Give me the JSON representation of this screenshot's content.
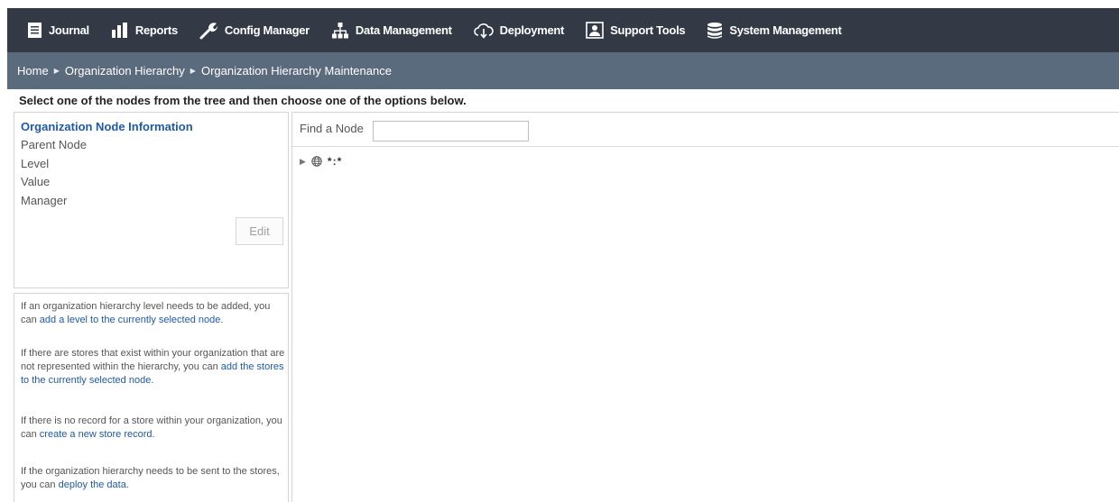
{
  "nav": {
    "items": [
      {
        "label": "Journal",
        "icon": "journal-icon"
      },
      {
        "label": "Reports",
        "icon": "reports-icon"
      },
      {
        "label": "Config Manager",
        "icon": "wrench-icon"
      },
      {
        "label": "Data Management",
        "icon": "org-chart-icon"
      },
      {
        "label": "Deployment",
        "icon": "cloud-download-icon"
      },
      {
        "label": "Support Tools",
        "icon": "support-icon"
      },
      {
        "label": "System Management",
        "icon": "database-icon"
      }
    ]
  },
  "breadcrumb": {
    "items": [
      "Home",
      "Organization Hierarchy",
      "Organization Hierarchy Maintenance"
    ]
  },
  "instruction": "Select one of the nodes from the tree and then choose one of the options below.",
  "info": {
    "title": "Organization Node Information",
    "parent_node": "Parent Node",
    "level": "Level",
    "value": "Value",
    "manager": "Manager",
    "edit_label": "Edit"
  },
  "help": {
    "p1_text": "If an organization hierarchy level needs to be added, you can ",
    "p1_link": "add a level to the currently selected node.",
    "p2_text": "If there are stores that exist within your organization that are not represented within the hierarchy, you can ",
    "p2_link": "add the stores to the currently selected node.",
    "p3_text": "If there is no record for a store within your organization, you can ",
    "p3_link": "create a new store record.",
    "p4_text": "If the organization hierarchy needs to be sent to the stores, you can ",
    "p4_link": "deploy the data."
  },
  "tree": {
    "find_label": "Find a Node",
    "find_value": "",
    "root_node": "*:*"
  },
  "colors": {
    "nav_bg": "#343a45",
    "breadcrumb_bg": "#5b6b7e",
    "link": "#1f5aa8"
  }
}
